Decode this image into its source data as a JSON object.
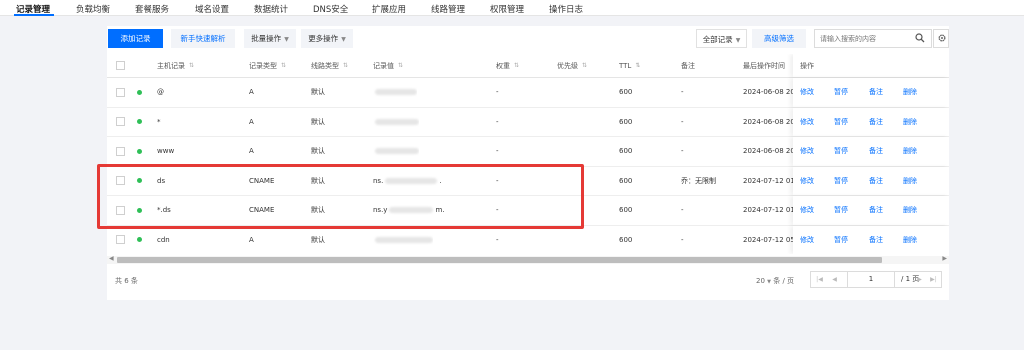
{
  "topnav": {
    "tabs": [
      "记录管理",
      "负载均衡",
      "套餐服务",
      "域名设置",
      "数据统计",
      "DNS安全",
      "扩展应用",
      "线路管理",
      "权限管理",
      "操作日志"
    ]
  },
  "toolbar": {
    "add_record": "添加记录",
    "quick_resolve": "新手快速解析",
    "batch_ops": "批量操作",
    "more_ops": "更多操作",
    "all_records": "全部记录",
    "advanced_filter": "高级筛选",
    "search_placeholder": "请输入搜索的内容"
  },
  "table": {
    "headers": [
      "主机记录",
      "记录类型",
      "线路类型",
      "记录值",
      "权重",
      "优先级",
      "TTL",
      "备注",
      "最后操作时间",
      "操作"
    ],
    "rows": [
      {
        "host": "@",
        "type": "A",
        "line": "默认",
        "weight": "-",
        "ttl": "600",
        "note": "-",
        "time": "2024-06-08 20"
      },
      {
        "host": "*",
        "type": "A",
        "line": "默认",
        "weight": "-",
        "ttl": "600",
        "note": "-",
        "time": "2024-06-08 20"
      },
      {
        "host": "www",
        "type": "A",
        "line": "默认",
        "weight": "-",
        "ttl": "600",
        "note": "-",
        "time": "2024-06-08 20"
      },
      {
        "host": "ds",
        "type": "CNAME",
        "line": "默认",
        "value_prefix": "ns.",
        "value_suffix": ".",
        "weight": "-",
        "ttl": "600",
        "note": "乔：无限制",
        "time": "2024-07-12 01"
      },
      {
        "host": "*.ds",
        "type": "CNAME",
        "line": "默认",
        "value_prefix": "ns.y",
        "value_suffix": "m.",
        "weight": "-",
        "ttl": "600",
        "note": "-",
        "time": "2024-07-12 01"
      },
      {
        "host": "cdn",
        "type": "A",
        "line": "默认",
        "weight": "-",
        "ttl": "600",
        "note": "-",
        "time": "2024-07-12 05"
      }
    ],
    "actions": [
      "修改",
      "暂停",
      "备注",
      "删除"
    ]
  },
  "footer": {
    "total": "共 6 条",
    "page_size": "20",
    "page_size_unit": "条 / 页",
    "page_current": "1",
    "page_total": "/ 1 页"
  },
  "colors": {
    "primary": "#006eff",
    "status_ok": "#2fbf57",
    "highlight": "#e53935"
  }
}
